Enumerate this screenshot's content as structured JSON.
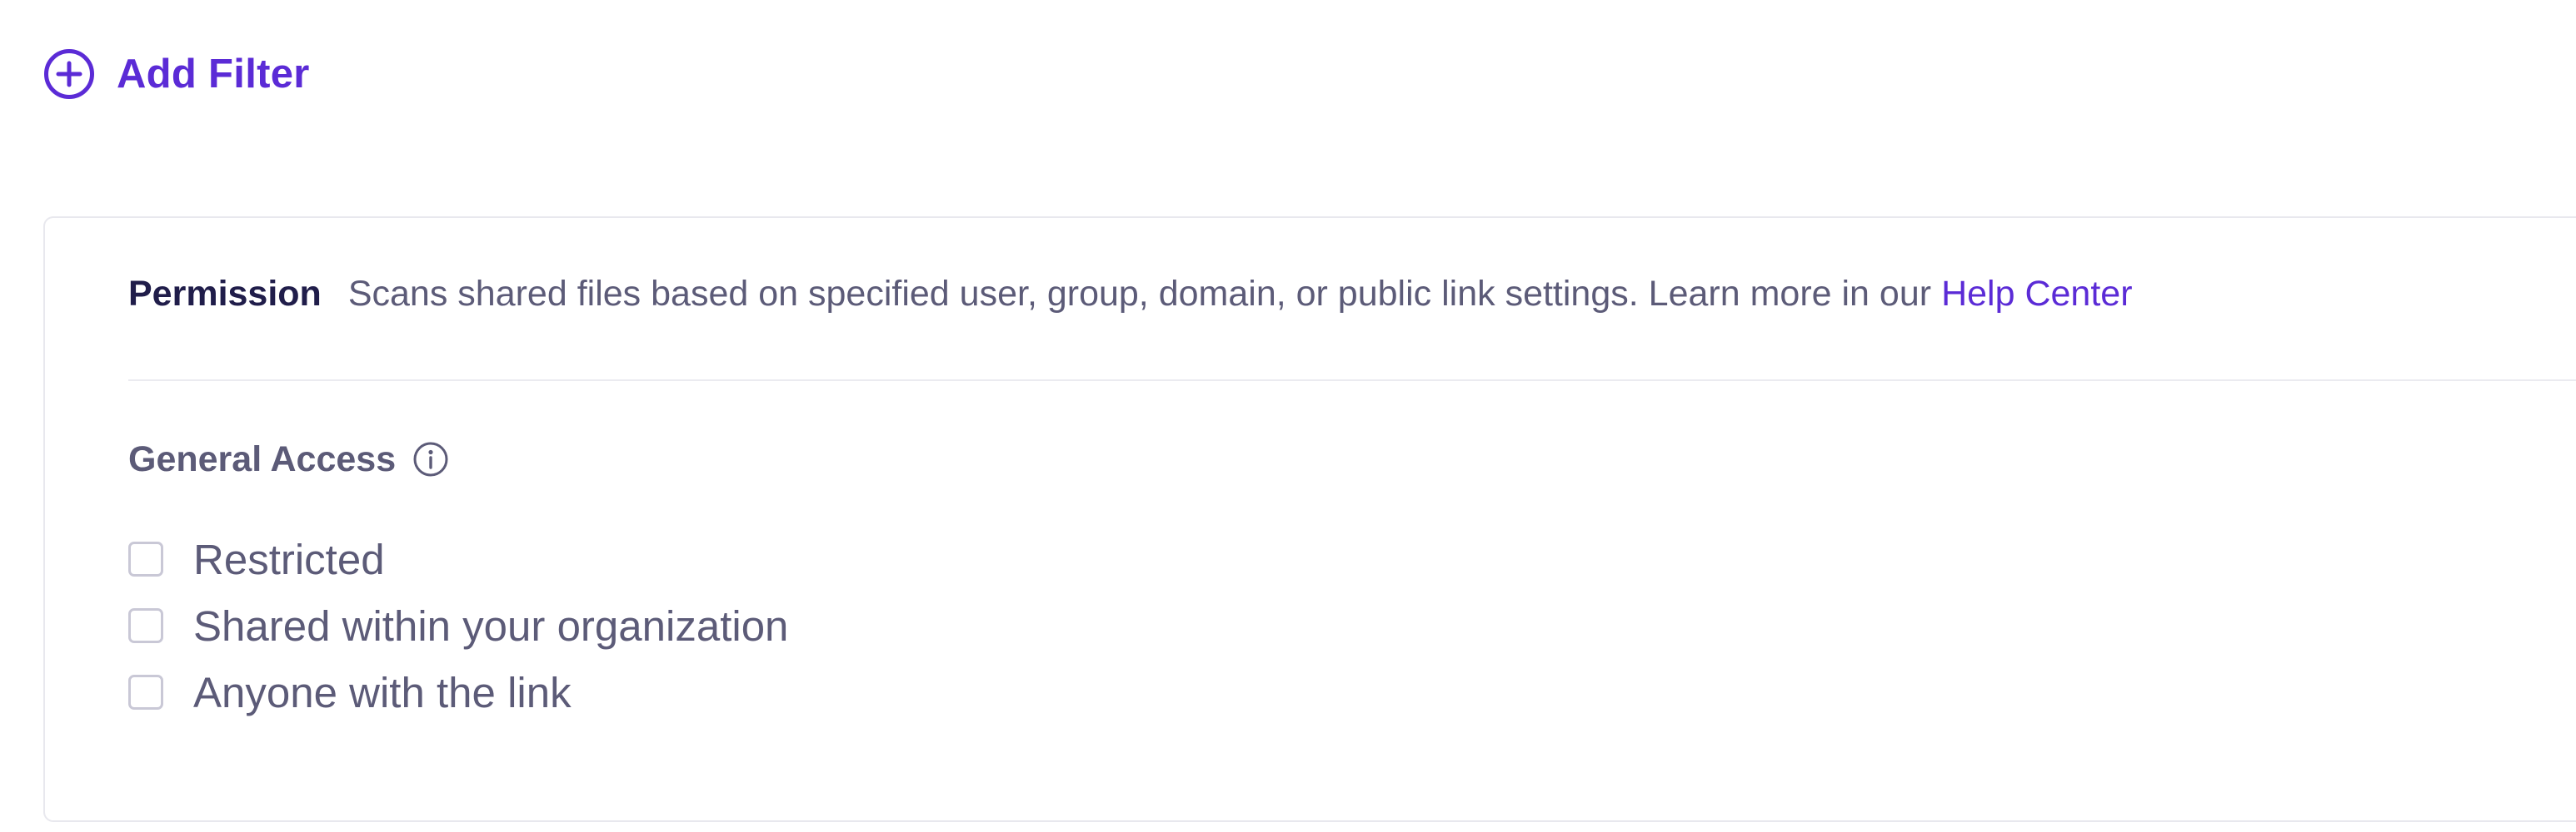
{
  "toolbar": {
    "add_filter_label": "Add Filter",
    "add_filter_icon": "plus-circle-icon"
  },
  "permission": {
    "title": "Permission",
    "description": "Scans shared files based on specified user, group, domain, or public link settings. Learn more in our",
    "help_link": "Help Center"
  },
  "general_access": {
    "title": "General Access",
    "info_icon": "info-icon",
    "options": [
      {
        "label": "Restricted",
        "checked": false
      },
      {
        "label": "Shared within your organization",
        "checked": false
      },
      {
        "label": "Anyone with the link",
        "checked": false
      }
    ]
  },
  "colors": {
    "accent": "#5b2bd6",
    "heading": "#201d4a",
    "text": "#5c5b78",
    "border": "#e8e8ee"
  }
}
